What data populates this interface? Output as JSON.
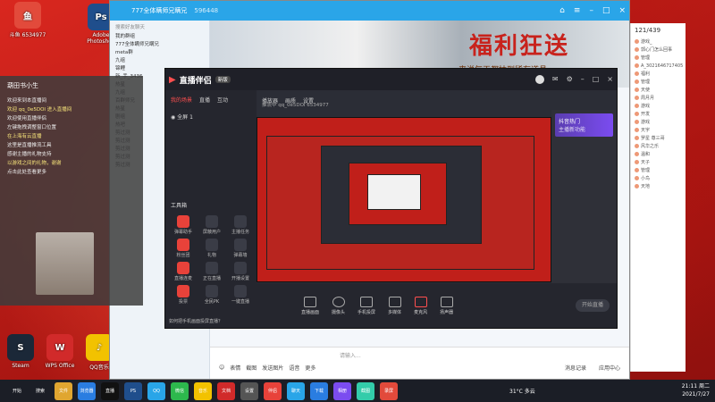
{
  "desktop": {
    "icons": [
      {
        "label": "斗鱼 6534977",
        "icon": "douyu-icon",
        "color": "#e24a3b"
      },
      {
        "label": "Adobe Photoshop",
        "icon": "ps-icon",
        "color": "#1f4e8c"
      },
      {
        "label": "Steam",
        "icon": "steam-icon",
        "color": "#1b2838"
      },
      {
        "label": "WPS Office",
        "icon": "wps-icon",
        "color": "#d12a2a"
      },
      {
        "label": "QQ音乐",
        "icon": "qqmusic-icon",
        "color": "#f2c200"
      }
    ]
  },
  "qq_window": {
    "title": "777全体瞒师兄瞒兄",
    "group_id": "596448",
    "search_placeholder": "搜索好友聊天",
    "tree_items": [
      "我的群组",
      "777全体瞒师兄瞒兄",
      "meta群",
      "九组",
      "锦鲤",
      "新_手_3436",
      "热星",
      "九组",
      "百群师兄",
      "热星",
      "剧组",
      "热吧",
      "剪过测",
      "剪过测",
      "剪过测",
      "剪过测",
      "剪过测"
    ],
    "banner_title": "福利狂送",
    "banner_sub": "来说每天都抽到稀有道具",
    "input_placeholder": "请输入...",
    "toolbar": [
      "表情",
      "截图",
      "发送图片",
      "语音",
      "更多"
    ],
    "bottom_right": [
      "消息记录",
      "应用中心"
    ]
  },
  "member_panel": {
    "count": "121/439",
    "members": [
      "游戏_",
      "郭心门怎么回事",
      "管理",
      "A_3021646717405",
      "福利",
      "管理",
      "天使",
      "周月月",
      "游戏",
      "开发",
      "游戏",
      "天宇",
      "罗星 尊三哥",
      "风华之乐",
      "温和",
      "天子",
      "管理",
      "小鸟",
      "天地"
    ]
  },
  "phone_overlay": {
    "name": "葫田书小生",
    "lines": [
      "欢迎来到本直播间",
      "欢迎 qq_0e5DOI 进入直播间",
      "欢迎使用直播伴侣",
      "左键拖拽调整窗口位置",
      "在上海有云直播",
      "这里是直播推流工具",
      "感谢主播的礼物支持",
      "以游戏之间的礼物，谢谢",
      "点击此处查看更多"
    ]
  },
  "zhibo": {
    "logo": "直播伴侣",
    "version": "新版",
    "left_tabs": [
      "我的场景",
      "直播",
      "互动"
    ],
    "scene_label": "全屏 1",
    "tools_title": "工具箱",
    "tools": [
      "弹幕助手",
      "屏蔽用户",
      "主播任务",
      "粉丝团",
      "礼物",
      "弹幕墙",
      "直播连麦",
      "正在直播",
      "开播设置",
      "投票",
      "全民PK",
      "一键直播"
    ],
    "bottom_tip": "如何把手机画面投屏直播？",
    "top_tabs": [
      "播放器",
      "画质",
      "设置"
    ],
    "room_info": "推流中 qq_0e5DOI  6534977",
    "right_adv_title": "抖音热门",
    "right_adv_sub": "主播新功能",
    "controls": [
      "直播画面",
      "摄像头",
      "手机投屏",
      "多媒体",
      "麦克风",
      "扬声器"
    ],
    "start_button": "开始直播"
  },
  "taskbar": {
    "items": [
      "开始",
      "搜索",
      "文件",
      "浏览器",
      "直播",
      "PS",
      "QQ",
      "微信",
      "音乐",
      "文档",
      "设置",
      "伴侣",
      "聊天",
      "下载",
      "相册",
      "截图",
      "录屏"
    ],
    "weather": "31°C 多云",
    "time": "21:11 周二",
    "date": "2021/7/27"
  }
}
